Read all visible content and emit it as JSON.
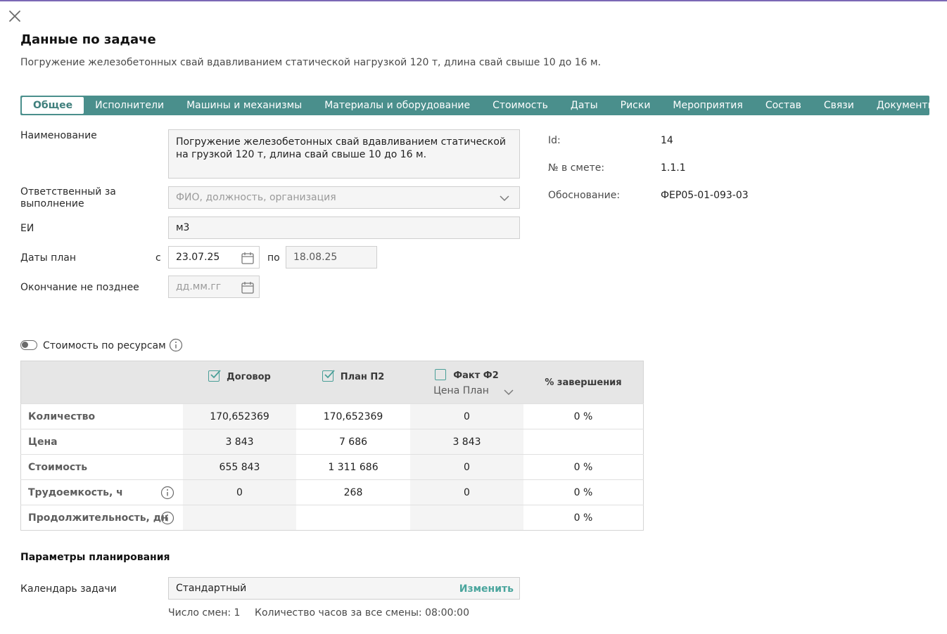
{
  "header": {
    "title": "Данные по задаче",
    "subtitle": "Погружение железобетонных свай вдавливанием статической нагрузкой 120 т, длина свай свыше 10 до 16 м."
  },
  "tabs": [
    {
      "label": "Общее",
      "active": true
    },
    {
      "label": "Исполнители"
    },
    {
      "label": "Машины и механизмы"
    },
    {
      "label": "Материалы и оборудование"
    },
    {
      "label": "Стоимость"
    },
    {
      "label": "Даты"
    },
    {
      "label": "Риски"
    },
    {
      "label": "Мероприятия"
    },
    {
      "label": "Состав"
    },
    {
      "label": "Связи"
    },
    {
      "label": "Документы"
    }
  ],
  "form": {
    "name_label": "Наименование",
    "name_value": "Погружение железобетонных свай вдавливанием статической на грузкой 120 т, длина свай свыше 10 до 16 м.",
    "responsible_label": "Ответственный за выполнение",
    "responsible_placeholder": "ФИО, должность, организация",
    "unit_label": "ЕИ",
    "unit_value": "м3",
    "dates_label": "Даты план",
    "from_label": "с",
    "date_from": "23.07.25",
    "to_label": "по",
    "date_to": "18.08.25",
    "deadline_label": "Окончание не позднее",
    "deadline_placeholder": "дд.мм.гг"
  },
  "info": {
    "id_label": "Id:",
    "id_value": "14",
    "estimate_label": "№ в смете:",
    "estimate_value": "1.1.1",
    "basis_label": "Обоснование:",
    "basis_value": "ФЕР05-01-093-03"
  },
  "cost_toggle": {
    "label": "Стоимость по ресурсам",
    "on": false
  },
  "cost_table": {
    "headers": {
      "contract": "Договор",
      "plan": "План П2",
      "fact": "Факт Ф2",
      "price_select": "Цена План",
      "completion": "% завершения"
    },
    "checked": {
      "contract": true,
      "plan": true,
      "fact": false
    },
    "rows": [
      {
        "label": "Количество",
        "contract": "170,652369",
        "plan": "170,652369",
        "fact": "0",
        "completion": "0 %",
        "info": false
      },
      {
        "label": "Цена",
        "contract": "3 843",
        "plan": "7 686",
        "fact": "3 843",
        "completion": "",
        "info": false
      },
      {
        "label": "Стоимость",
        "contract": "655 843",
        "plan": "1 311 686",
        "fact": "0",
        "completion": "0 %",
        "info": false
      },
      {
        "label": "Трудоемкость, ч",
        "contract": "0",
        "plan": "268",
        "fact": "0",
        "completion": "0 %",
        "info": true
      },
      {
        "label": "Продолжительность, дн",
        "contract": "",
        "plan": "",
        "fact": "",
        "completion": "0 %",
        "info": true
      }
    ]
  },
  "planning": {
    "section_title": "Параметры планирования",
    "calendar_label": "Календарь задачи",
    "calendar_value": "Стандартный",
    "change_label": "Изменить",
    "shifts_text": "Число смен: 1",
    "hours_text": "Количество часов за все смены: 08:00:00"
  },
  "colors": {
    "accent": "#4a8f8c",
    "link": "#4aa59d",
    "topline": "#7b68b5"
  }
}
